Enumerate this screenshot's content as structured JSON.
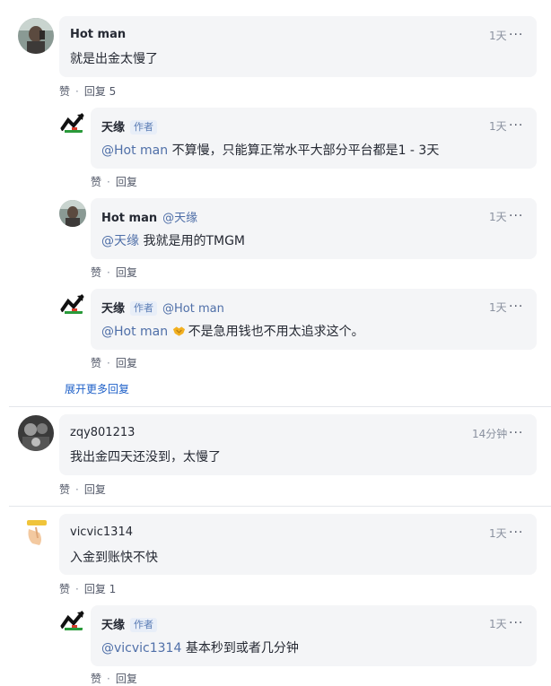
{
  "comments": [
    {
      "author": "Hot man",
      "time": "1天",
      "more": "···",
      "text": "就是出金太慢了",
      "like": "赞",
      "reply": "回复 5",
      "replies": [
        {
          "author": "天缘",
          "tag": "作者",
          "time": "1天",
          "more": "···",
          "mention": "@Hot man",
          "text": "不算慢，只能算正常水平大部分平台都是1 - 3天",
          "like": "赞",
          "reply": "回复"
        },
        {
          "author": "Hot man",
          "reply_to": "@天缘",
          "time": "1天",
          "more": "···",
          "mention": "@天缘",
          "text": "我就是用的TMGM",
          "like": "赞",
          "reply": "回复"
        },
        {
          "author": "天缘",
          "tag": "作者",
          "reply_to": "@Hot man",
          "time": "1天",
          "more": "···",
          "mention": "@Hot man",
          "emoji": "handshake-emoji",
          "text": "不是急用钱也不用太追求这个。",
          "like": "赞",
          "reply": "回复"
        }
      ],
      "expand": "展开更多回复"
    },
    {
      "author": "zqy801213",
      "time": "14分钟",
      "more": "···",
      "text": "我出金四天还没到，太慢了",
      "like": "赞",
      "reply": "回复"
    },
    {
      "author": "vicvic1314",
      "time": "1天",
      "more": "···",
      "text": "入金到账快不快",
      "like": "赞",
      "reply": "回复 1",
      "replies": [
        {
          "author": "天缘",
          "tag": "作者",
          "time": "1天",
          "more": "···",
          "mention": "@vicvic1314",
          "text": "基本秒到或者几分钟",
          "like": "赞",
          "reply": "回复"
        }
      ]
    }
  ],
  "colors": {
    "bubble": "#f4f5f7",
    "mention": "#4f6fa8",
    "link": "#1e60c8",
    "muted": "#8a919f"
  }
}
